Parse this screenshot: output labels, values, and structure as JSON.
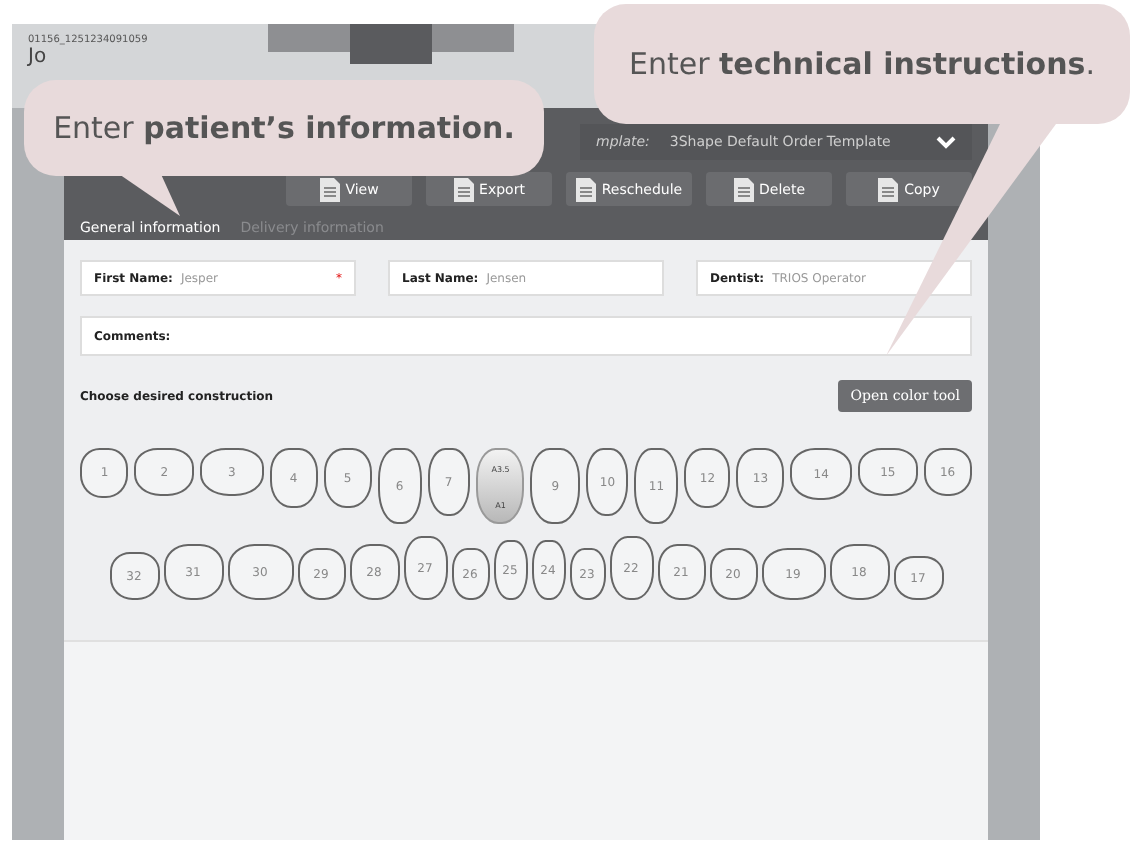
{
  "header": {
    "id": "01156_1251234091059",
    "name": "Jo"
  },
  "header_tabs": [
    {
      "selected": false
    },
    {
      "selected": true
    },
    {
      "selected": false
    }
  ],
  "callouts": [
    {
      "text": "Enter **patient’s information.**"
    },
    {
      "text": "Enter **technical instructions**."
    }
  ],
  "template": {
    "label": "mplate:",
    "value": "3Shape Default Order Template"
  },
  "toolbar": [
    {
      "label": "View"
    },
    {
      "label": "Export"
    },
    {
      "label": "Reschedule"
    },
    {
      "label": "Delete"
    },
    {
      "label": "Copy"
    }
  ],
  "tabs": [
    {
      "label": "General information",
      "selected": true
    },
    {
      "label": "Delivery information",
      "selected": false
    }
  ],
  "fields": [
    {
      "label": "First Name:",
      "value": "Jesper",
      "marker": "*"
    },
    {
      "label": "Last Name:",
      "value": "Jensen"
    },
    {
      "label": "Dentist:",
      "value": "TRIOS Operator"
    }
  ],
  "comments": {
    "label": "Comments:"
  },
  "construction": {
    "title": "Choose desired construction",
    "button": "Open color tool"
  },
  "upper_teeth": [
    {
      "label": "1",
      "selected": false
    },
    {
      "label": "2",
      "selected": false
    },
    {
      "label": "3",
      "selected": false
    },
    {
      "label": "4",
      "selected": false
    },
    {
      "label": "5",
      "selected": false
    },
    {
      "label": "6",
      "selected": false
    },
    {
      "label": "7",
      "selected": false
    },
    {
      "selected": true,
      "shades": [
        "A3.5",
        "A1"
      ]
    },
    {
      "label": "9",
      "selected": false
    },
    {
      "label": "10",
      "selected": false
    },
    {
      "label": "11",
      "selected": false
    },
    {
      "label": "12",
      "selected": false
    },
    {
      "label": "13",
      "selected": false
    },
    {
      "label": "14",
      "selected": false
    },
    {
      "label": "15",
      "selected": false
    },
    {
      "label": "16",
      "selected": false
    }
  ],
  "lower_teeth": [
    {
      "label": "32",
      "selected": false
    },
    {
      "label": "31",
      "selected": false
    },
    {
      "label": "30",
      "selected": false
    },
    {
      "label": "29",
      "selected": false
    },
    {
      "label": "28",
      "selected": false
    },
    {
      "label": "27",
      "selected": false
    },
    {
      "label": "26",
      "selected": false
    },
    {
      "label": "25",
      "selected": false
    },
    {
      "label": "24",
      "selected": false
    },
    {
      "label": "23",
      "selected": false
    },
    {
      "label": "22",
      "selected": false
    },
    {
      "label": "21",
      "selected": false
    },
    {
      "label": "20",
      "selected": false
    },
    {
      "label": "19",
      "selected": false
    },
    {
      "label": "18",
      "selected": false
    },
    {
      "label": "17",
      "selected": false
    }
  ]
}
